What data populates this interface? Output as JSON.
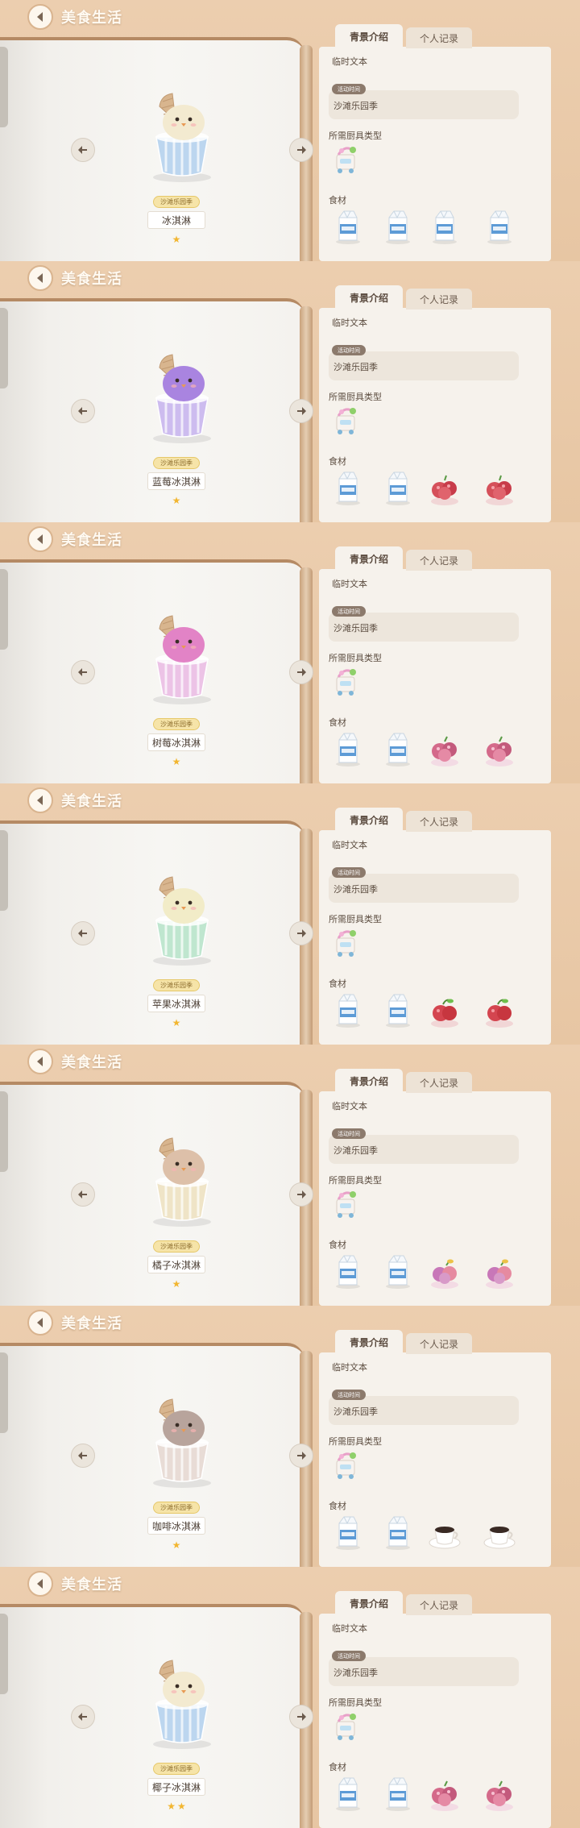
{
  "screen": {
    "title": "美食生活"
  },
  "tabs": [
    {
      "label": "青景介绍"
    },
    {
      "label": "个人记录"
    }
  ],
  "labels": {
    "text": "临时文本",
    "event_tag": "活动时间",
    "tool_type": "所需厨具类型",
    "ingredients": "食材"
  },
  "colors": {
    "background": "#e9c9a8",
    "page": "#f7f6f3",
    "accent": "#b58a64",
    "star": "#f2b630"
  },
  "cards": [
    {
      "name": "冰淇淋",
      "season": "沙滩乐园季",
      "event": "沙滩乐园季",
      "stars": 1,
      "cup_color": "#bcd6ef",
      "scoop_color": "#f3ead0",
      "ingredients": [
        {
          "icon": "milk-carton"
        },
        {
          "icon": "milk-carton"
        },
        {
          "icon": "milk-carton"
        },
        {
          "icon": "milk-carton"
        }
      ]
    },
    {
      "name": "蓝莓冰淇淋",
      "season": "沙滩乐园季",
      "event": "沙滩乐园季",
      "stars": 1,
      "cup_color": "#cdbcef",
      "scoop_color": "#a984e0",
      "ingredients": [
        {
          "icon": "milk-carton"
        },
        {
          "icon": "milk-carton"
        },
        {
          "icon": "berry-red"
        },
        {
          "icon": "berry-red"
        }
      ]
    },
    {
      "name": "树莓冰淇淋",
      "season": "沙滩乐园季",
      "event": "沙滩乐园季",
      "stars": 1,
      "cup_color": "#ecc3e6",
      "scoop_color": "#e283c6",
      "ingredients": [
        {
          "icon": "milk-carton"
        },
        {
          "icon": "milk-carton"
        },
        {
          "icon": "berry-pink"
        },
        {
          "icon": "berry-pink"
        }
      ]
    },
    {
      "name": "苹果冰淇淋",
      "season": "沙滩乐园季",
      "event": "沙滩乐园季",
      "stars": 1,
      "cup_color": "#bfe6cf",
      "scoop_color": "#f2ecc8",
      "ingredients": [
        {
          "icon": "milk-carton"
        },
        {
          "icon": "milk-carton"
        },
        {
          "icon": "apple-red"
        },
        {
          "icon": "apple-red"
        }
      ]
    },
    {
      "name": "橘子冰淇淋",
      "season": "沙滩乐园季",
      "event": "沙滩乐园季",
      "stars": 1,
      "cup_color": "#efe4c7",
      "scoop_color": "#ddc0a9",
      "ingredients": [
        {
          "icon": "milk-carton"
        },
        {
          "icon": "milk-carton"
        },
        {
          "icon": "berry-mixed"
        },
        {
          "icon": "berry-mixed"
        }
      ]
    },
    {
      "name": "咖啡冰淇淋",
      "season": "沙滩乐园季",
      "event": "沙滩乐园季",
      "stars": 1,
      "cup_color": "#e8dcd6",
      "scoop_color": "#b8a49c",
      "ingredients": [
        {
          "icon": "milk-carton"
        },
        {
          "icon": "milk-carton"
        },
        {
          "icon": "coffee-cup"
        },
        {
          "icon": "coffee-cup"
        }
      ]
    },
    {
      "name": "椰子冰淇淋",
      "season": "沙滩乐园季",
      "event": "沙滩乐园季",
      "stars": 2,
      "cup_color": "#bcd6ef",
      "scoop_color": "#f3ead0",
      "ingredients": [
        {
          "icon": "milk-carton"
        },
        {
          "icon": "milk-carton"
        },
        {
          "icon": "berry-pink"
        },
        {
          "icon": "berry-pink"
        }
      ]
    }
  ]
}
